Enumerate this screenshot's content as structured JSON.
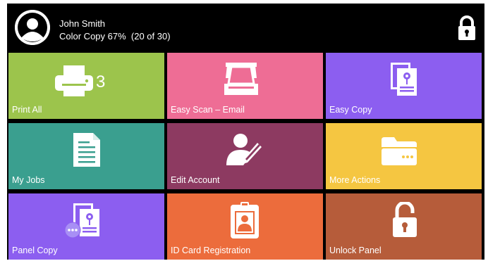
{
  "header": {
    "user_name": "John Smith",
    "quota_text": "Color Copy 67%  (20 of 30)",
    "avatar_icon": "user-avatar-icon",
    "lock_icon": "padlock-closed-icon"
  },
  "tiles": [
    {
      "label": "Print All",
      "icon": "printer-icon",
      "badge": "3",
      "color": "#9cc44c"
    },
    {
      "label": "Easy Scan – Email",
      "icon": "scanner-icon",
      "color": "#ee6d95"
    },
    {
      "label": "Easy Copy",
      "icon": "copy-document-icon",
      "color": "#8c5ef0"
    },
    {
      "label": "My Jobs",
      "icon": "document-icon",
      "color": "#3a9f8f"
    },
    {
      "label": "Edit Account",
      "icon": "user-edit-icon",
      "color": "#8d3a61"
    },
    {
      "label": "More Actions",
      "icon": "folder-icon",
      "color": "#f5c641"
    },
    {
      "label": "Panel Copy",
      "icon": "panel-copy-icon",
      "color": "#8c5ef0"
    },
    {
      "label": "ID Card Registration",
      "icon": "id-card-icon",
      "color": "#ec6c3c"
    },
    {
      "label": "Unlock Panel",
      "icon": "padlock-open-icon",
      "color": "#b65c3a"
    }
  ]
}
